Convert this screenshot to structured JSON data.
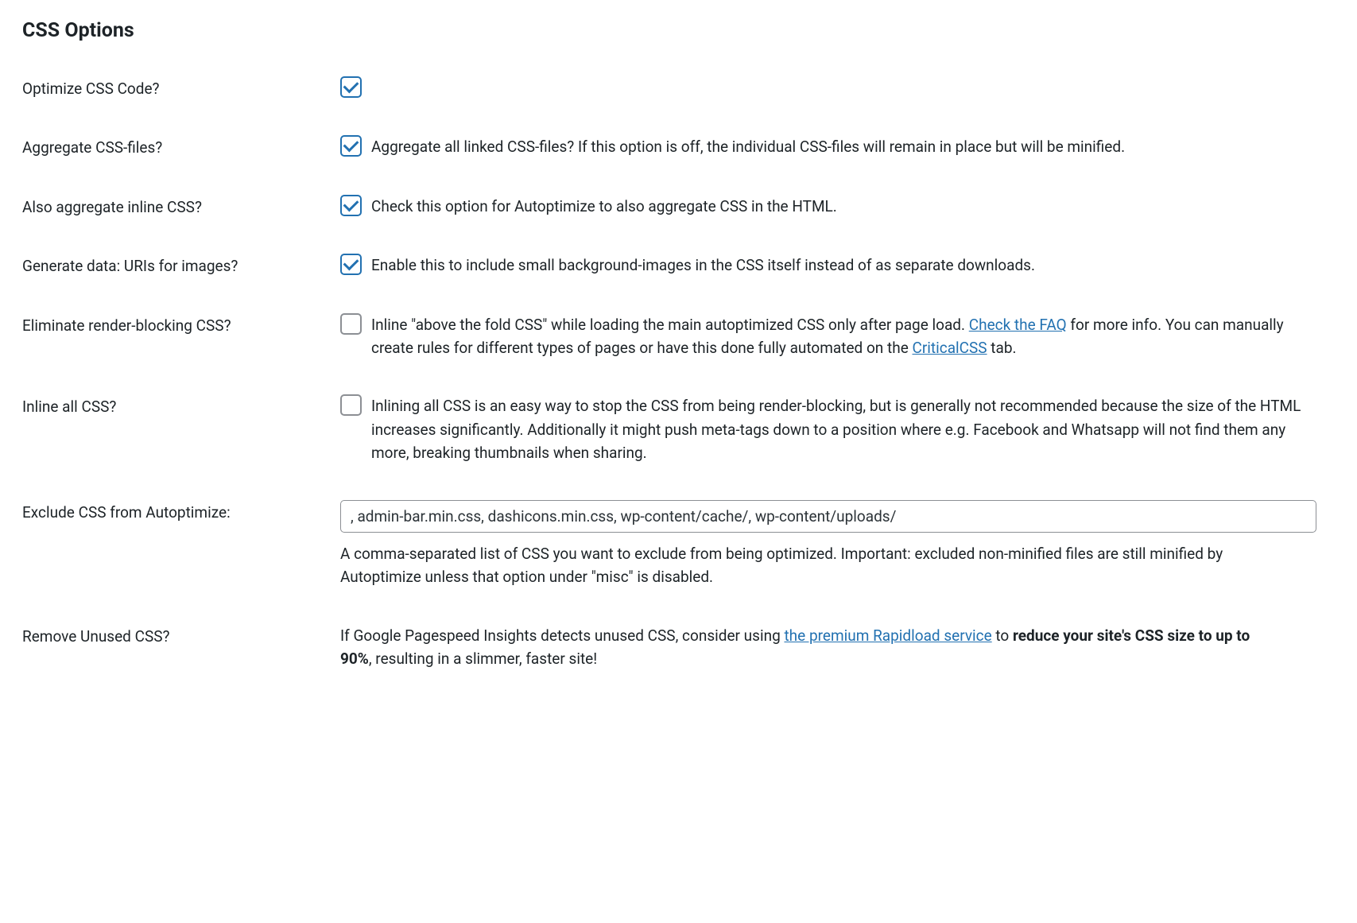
{
  "section_title": "CSS Options",
  "rows": {
    "optimize": {
      "label": "Optimize CSS Code?"
    },
    "aggregate": {
      "label": "Aggregate CSS-files?",
      "desc": "Aggregate all linked CSS-files? If this option is off, the individual CSS-files will remain in place but will be minified."
    },
    "inline_agg": {
      "label": "Also aggregate inline CSS?",
      "desc": "Check this option for Autoptimize to also aggregate CSS in the HTML."
    },
    "datauri": {
      "label": "Generate data: URIs for images?",
      "desc": "Enable this to include small background-images in the CSS itself instead of as separate downloads."
    },
    "render_blocking": {
      "label": "Eliminate render-blocking CSS?",
      "desc_pre": "Inline \"above the fold CSS\" while loading the main autoptimized CSS only after page load. ",
      "link1": "Check the FAQ",
      "desc_mid": " for more info. You can manually create rules for different types of pages or have this done fully automated on the ",
      "link2": "CriticalCSS",
      "desc_post": " tab."
    },
    "inline_all": {
      "label": "Inline all CSS?",
      "desc": "Inlining all CSS is an easy way to stop the CSS from being render-blocking, but is generally not recommended because the size of the HTML increases significantly. Additionally it might push meta-tags down to a position where e.g. Facebook and Whatsapp will not find them any more, breaking thumbnails when sharing."
    },
    "exclude": {
      "label": "Exclude CSS from Autoptimize:",
      "value": ", admin-bar.min.css, dashicons.min.css, wp-content/cache/, wp-content/uploads/",
      "desc": "A comma-separated list of CSS you want to exclude from being optimized. Important: excluded non-minified files are still minified by Autoptimize unless that option under \"misc\" is disabled."
    },
    "unused": {
      "label": "Remove Unused CSS?",
      "desc_pre": "If Google Pagespeed Insights detects unused CSS, consider using ",
      "link": "the premium Rapidload service",
      "desc_mid": " to ",
      "bold": "reduce your site's CSS size to up to 90%",
      "desc_post": ", resulting in a slimmer, faster site!"
    }
  }
}
